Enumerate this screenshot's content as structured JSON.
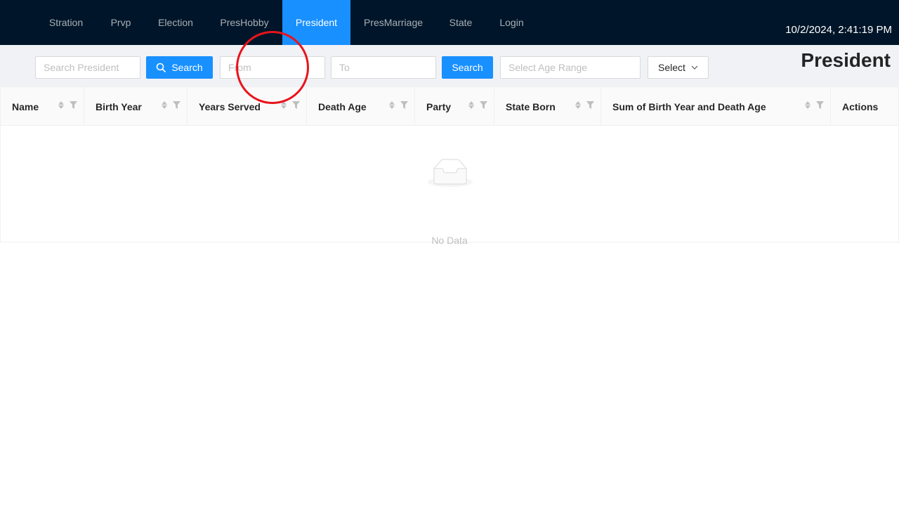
{
  "nav": {
    "items": [
      {
        "label": "Stration"
      },
      {
        "label": "Prvp"
      },
      {
        "label": "Election"
      },
      {
        "label": "PresHobby"
      },
      {
        "label": "President"
      },
      {
        "label": "PresMarriage"
      },
      {
        "label": "State"
      },
      {
        "label": "Login"
      }
    ],
    "active_item": "President",
    "clock": "10/2/2024, 2:41:19 PM"
  },
  "toolbar": {
    "search_placeholder": "Search President",
    "search_button": "Search",
    "from_placeholder": "From",
    "to_placeholder": "To",
    "range_search_button": "Search",
    "age_range_placeholder": "Select Age Range",
    "select_label": "Select",
    "page_title": "President"
  },
  "table": {
    "columns": [
      "Name",
      "Birth Year",
      "Years Served",
      "Death Age",
      "Party",
      "State Born",
      "Sum of Birth Year and Death Age",
      "Actions"
    ],
    "rows": [],
    "empty_text": "No Data"
  },
  "colors": {
    "nav_background": "#001529",
    "accent": "#1890ff",
    "annotation": "#e8141c"
  },
  "icons": [
    "search-icon",
    "chevron-down-icon",
    "sort-icon",
    "filter-icon",
    "empty-inbox-icon"
  ]
}
